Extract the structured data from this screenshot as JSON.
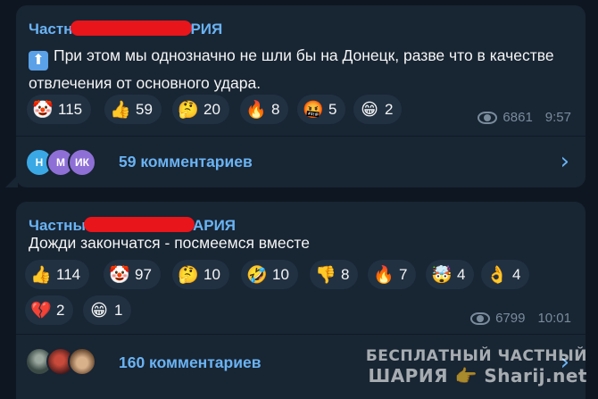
{
  "messages": [
    {
      "sender_prefix": "Частн",
      "sender_suffix": "РИЯ",
      "text_icon": "⬆",
      "text": "При этом мы однозначно не шли бы на Донецк, разве что в качестве отвлечения от основного удара.",
      "reactions": [
        {
          "emoji": "🤡",
          "icon": "clown-icon",
          "count": "115"
        },
        {
          "emoji": "👍",
          "icon": "thumbs-up-icon",
          "count": "59"
        },
        {
          "emoji": "🤔",
          "icon": "thinking-icon",
          "count": "20"
        },
        {
          "emoji": "🔥",
          "icon": "fire-icon",
          "count": "8"
        },
        {
          "emoji": "🤬",
          "icon": "swearing-face-icon",
          "count": "5"
        },
        {
          "emoji": "😁",
          "icon": "grin-icon",
          "count": "2"
        }
      ],
      "views": "6861",
      "time": "9:57",
      "comment_avatars": [
        {
          "letter": "Н",
          "color": "#3aa8e4"
        },
        {
          "letter": "М",
          "color": "#8e6fd6"
        },
        {
          "letter": "ИК",
          "color": "#8e6fd6"
        }
      ],
      "comments_label": "59 комментариев"
    },
    {
      "sender_prefix": "Частны",
      "sender_suffix": "АРИЯ",
      "text": "Дожди закончатся - посмеемся вместе",
      "reactions": [
        {
          "emoji": "👍",
          "icon": "thumbs-up-icon",
          "count": "114"
        },
        {
          "emoji": "🤡",
          "icon": "clown-icon",
          "count": "97"
        },
        {
          "emoji": "🤔",
          "icon": "thinking-icon",
          "count": "10"
        },
        {
          "emoji": "🤣",
          "icon": "rofl-icon",
          "count": "10"
        },
        {
          "emoji": "👎",
          "icon": "thumbs-down-icon",
          "count": "8"
        },
        {
          "emoji": "🔥",
          "icon": "fire-icon",
          "count": "7"
        },
        {
          "emoji": "🤯",
          "icon": "exploding-head-icon",
          "count": "4"
        },
        {
          "emoji": "👌",
          "icon": "ok-hand-icon",
          "count": "4"
        },
        {
          "emoji": "💔",
          "icon": "broken-heart-icon",
          "count": "2"
        },
        {
          "emoji": "😁",
          "icon": "grin-icon",
          "count": "1"
        }
      ],
      "views": "6799",
      "time": "10:01",
      "comment_avatars": [
        {
          "letter": "",
          "color": "#4a5a55"
        },
        {
          "letter": "",
          "color": "#7a2a2a"
        },
        {
          "letter": "",
          "color": "#8a6a4a"
        }
      ],
      "comments_label": "160 комментариев"
    }
  ],
  "watermark": {
    "line1": "БЕСПЛАТНЫЙ  ЧАСТНЫЙ",
    "line2": "ШАРИЯ",
    "line2_icon": "👉",
    "line2_suffix": "Sharij.net"
  },
  "colors": {
    "background": "#0e1621",
    "bubble": "#182533",
    "accent": "#6ab3f3",
    "reaction_bg": "#213142",
    "meta": "#7a8b9c",
    "redaction": "#e8151b"
  }
}
